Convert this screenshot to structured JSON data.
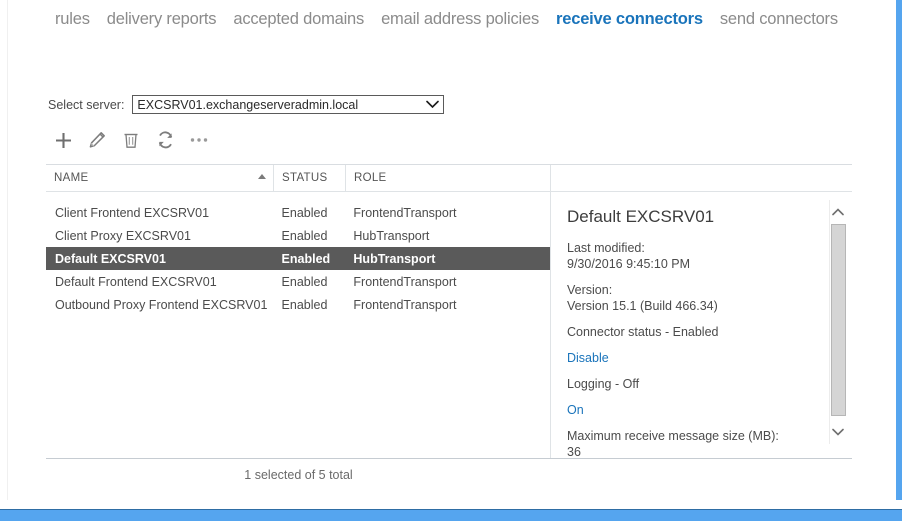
{
  "theme": {
    "accent_blue": "#1a74bb",
    "bar_blue": "#55a5ef",
    "selected_row_bg": "#5a5a5a",
    "text_gray": "#4b4b4b"
  },
  "tabs": [
    {
      "label": "rules",
      "active": false
    },
    {
      "label": "delivery reports",
      "active": false
    },
    {
      "label": "accepted domains",
      "active": false
    },
    {
      "label": "email address policies",
      "active": false
    },
    {
      "label": "receive connectors",
      "active": true
    },
    {
      "label": "send connectors",
      "active": false
    }
  ],
  "server_selector": {
    "label": "Select server:",
    "value": "EXCSRV01.exchangeserveradmin.local",
    "chevron_icon": "chevron-down-icon"
  },
  "toolbar": [
    {
      "name": "add-button",
      "icon": "plus-icon",
      "title": "Add"
    },
    {
      "name": "edit-button",
      "icon": "pencil-icon",
      "title": "Edit"
    },
    {
      "name": "delete-button",
      "icon": "trash-icon",
      "title": "Delete"
    },
    {
      "name": "refresh-button",
      "icon": "refresh-icon",
      "title": "Refresh"
    },
    {
      "name": "more-button",
      "icon": "ellipsis-icon",
      "title": "More options"
    }
  ],
  "list": {
    "columns": [
      {
        "key": "name",
        "label": "NAME",
        "sorted": "asc"
      },
      {
        "key": "status",
        "label": "STATUS",
        "sorted": ""
      },
      {
        "key": "role",
        "label": "ROLE",
        "sorted": ""
      }
    ],
    "rows": [
      {
        "name": "Client Frontend EXCSRV01",
        "status": "Enabled",
        "role": "FrontendTransport",
        "selected": false
      },
      {
        "name": "Client Proxy EXCSRV01",
        "status": "Enabled",
        "role": "HubTransport",
        "selected": false
      },
      {
        "name": "Default EXCSRV01",
        "status": "Enabled",
        "role": "HubTransport",
        "selected": true
      },
      {
        "name": "Default Frontend EXCSRV01",
        "status": "Enabled",
        "role": "FrontendTransport",
        "selected": false
      },
      {
        "name": "Outbound Proxy Frontend EXCSRV01",
        "status": "Enabled",
        "role": "FrontendTransport",
        "selected": false
      }
    ],
    "footer": "1 selected of 5 total"
  },
  "detail": {
    "title": "Default EXCSRV01",
    "last_modified_label": "Last modified:",
    "last_modified_value": "9/30/2016 9:45:10 PM",
    "version_label": "Version:",
    "version_value": "Version 15.1 (Build 466.34)",
    "connector_status": "Connector status - Enabled",
    "connector_status_action": "Disable",
    "logging_status": "Logging - Off",
    "logging_action": "On",
    "max_size_label": "Maximum receive message size (MB):",
    "max_size_value": "36",
    "scroll_up_icon": "chevron-up-icon",
    "scroll_down_icon": "chevron-down-icon"
  }
}
